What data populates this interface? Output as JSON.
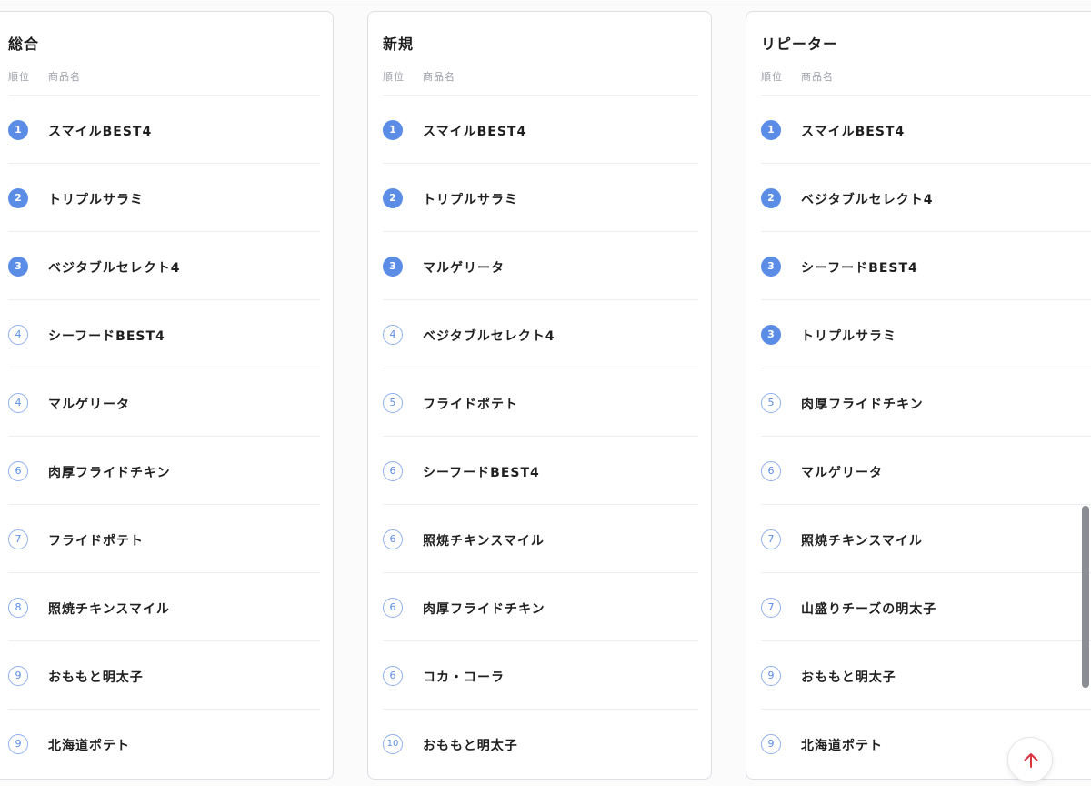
{
  "rank_header": "順位",
  "name_header": "商品名",
  "columns": [
    {
      "title": "総合",
      "items": [
        {
          "rank": "1",
          "name": "スマイルBEST4"
        },
        {
          "rank": "2",
          "name": "トリプルサラミ"
        },
        {
          "rank": "3",
          "name": "ベジタブルセレクト4"
        },
        {
          "rank": "4",
          "name": "シーフードBEST4"
        },
        {
          "rank": "4",
          "name": "マルゲリータ"
        },
        {
          "rank": "6",
          "name": "肉厚フライドチキン"
        },
        {
          "rank": "7",
          "name": "フライドポテト"
        },
        {
          "rank": "8",
          "name": "照焼チキンスマイル"
        },
        {
          "rank": "9",
          "name": "おももと明太子"
        },
        {
          "rank": "9",
          "name": "北海道ポテト"
        }
      ]
    },
    {
      "title": "新規",
      "items": [
        {
          "rank": "1",
          "name": "スマイルBEST4"
        },
        {
          "rank": "2",
          "name": "トリプルサラミ"
        },
        {
          "rank": "3",
          "name": "マルゲリータ"
        },
        {
          "rank": "4",
          "name": "ベジタブルセレクト4"
        },
        {
          "rank": "5",
          "name": "フライドポテト"
        },
        {
          "rank": "6",
          "name": "シーフードBEST4"
        },
        {
          "rank": "6",
          "name": "照焼チキンスマイル"
        },
        {
          "rank": "6",
          "name": "肉厚フライドチキン"
        },
        {
          "rank": "6",
          "name": "コカ・コーラ"
        },
        {
          "rank": "10",
          "name": "おももと明太子"
        }
      ]
    },
    {
      "title": "リピーター",
      "items": [
        {
          "rank": "1",
          "name": "スマイルBEST4"
        },
        {
          "rank": "2",
          "name": "ベジタブルセレクト4"
        },
        {
          "rank": "3",
          "name": "シーフードBEST4"
        },
        {
          "rank": "3",
          "name": "トリプルサラミ"
        },
        {
          "rank": "5",
          "name": "肉厚フライドチキン"
        },
        {
          "rank": "6",
          "name": "マルゲリータ"
        },
        {
          "rank": "7",
          "name": "照焼チキンスマイル"
        },
        {
          "rank": "7",
          "name": "山盛りチーズの明太子"
        },
        {
          "rank": "9",
          "name": "おももと明太子"
        },
        {
          "rank": "9",
          "name": "北海道ポテト"
        }
      ]
    }
  ],
  "colors": {
    "top_badge": "#5b8de6",
    "outline_badge": "#8fb0ee",
    "scroll_top_arrow": "#d9363e"
  },
  "icons": {
    "scroll_top": "arrow-up-icon"
  }
}
